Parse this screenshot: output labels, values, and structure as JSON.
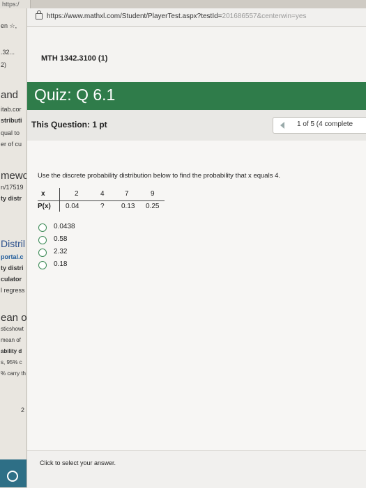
{
  "browser": {
    "tab_label": "https:/",
    "url_main": "https://www.mathxl.com/Student/PlayerTest.aspx?testId=",
    "url_dim": "201686557&centerwin=yes"
  },
  "background_window": {
    "lines": [
      "en ☆,",
      ".32...",
      "2)",
      "and",
      "itab.cor",
      "stributi",
      "qual to",
      "er of cu",
      "mewc",
      "n/17519",
      "ty distr",
      "Distril",
      "portal.c",
      "ty distri",
      "culator",
      "l regress",
      "ean of",
      "sticshowt",
      "mean of",
      "ability d",
      "s, 95% c",
      "% carry th",
      "2"
    ]
  },
  "course": {
    "title": "MTH 1342.3100 (1)"
  },
  "quiz": {
    "title": "Quiz: Q 6.1"
  },
  "question": {
    "points": "This Question: 1 pt",
    "counter": "1 of 5 (4 complete",
    "prompt": "Use the discrete probability distribution below to find the probability that x equals 4."
  },
  "distribution": {
    "x_label": "x",
    "p_label": "P(x)",
    "x_values": [
      "2",
      "4",
      "7",
      "9"
    ],
    "p_values": [
      "0.04",
      "?",
      "0.13",
      "0.25"
    ]
  },
  "options": [
    "0.0438",
    "0.58",
    "2.32",
    "0.18"
  ],
  "footer": {
    "message": "Click to select your answer."
  },
  "colors": {
    "quiz_bar": "#2f7c4a",
    "sidebar": "#2e6f86"
  }
}
